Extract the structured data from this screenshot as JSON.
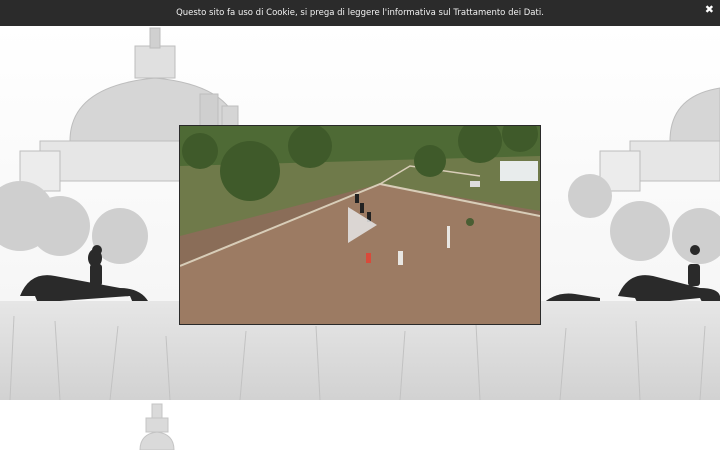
{
  "cookie_banner": {
    "message": "Questo sito fa uso di Cookie, si prega di leggere l'informativa sul Trattamento dei Dati.",
    "close_label": "✖"
  },
  "background": {
    "description_icon": "monument-dome-horse-rider-photo"
  },
  "video_player": {
    "play_icon": "play-icon",
    "thumbnail_icon": "riding-arena-aerial-image"
  },
  "colors": {
    "banner_bg": "#2b2b2b",
    "banner_text": "#f2f2f2",
    "play_button": "#e8e8e8"
  }
}
